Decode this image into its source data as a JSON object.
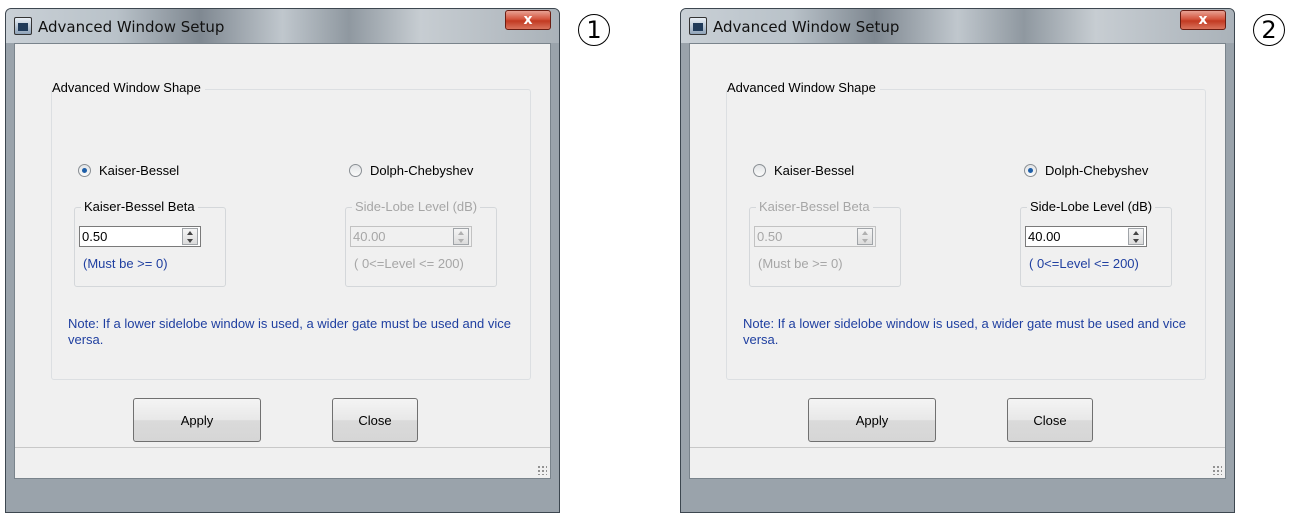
{
  "windows": [
    {
      "title": "Advanced Window Setup",
      "close_glyph": "x",
      "group_title": "Advanced Window Shape",
      "radio_kaiser": "Kaiser-Bessel",
      "radio_dolph": "Dolph-Chebyshev",
      "selected": "Kaiser-Bessel",
      "kaiser_title": "Kaiser-Bessel Beta",
      "kaiser_value": "0.50",
      "kaiser_hint": "(Must be >= 0)",
      "dolph_title": "Side-Lobe Level (dB)",
      "dolph_value": "40.00",
      "dolph_hint": "( 0<=Level <= 200)",
      "note": "Note: If a lower sidelobe window is used, a wider gate must be used and vice versa.",
      "apply_label": "Apply",
      "close_label": "Close",
      "badge": "1"
    },
    {
      "title": "Advanced Window Setup",
      "close_glyph": "x",
      "group_title": "Advanced Window Shape",
      "radio_kaiser": "Kaiser-Bessel",
      "radio_dolph": "Dolph-Chebyshev",
      "selected": "Dolph-Chebyshev",
      "kaiser_title": "Kaiser-Bessel Beta",
      "kaiser_value": "0.50",
      "kaiser_hint": "(Must be >= 0)",
      "dolph_title": "Side-Lobe Level (dB)",
      "dolph_value": "40.00",
      "dolph_hint": "( 0<=Level <= 200)",
      "note": "Note: If a lower sidelobe window is used, a wider gate must be used and vice versa.",
      "apply_label": "Apply",
      "close_label": "Close",
      "badge": "2"
    }
  ],
  "colors": {
    "hint_text": "#1f3fa0",
    "radio_dot": "#1f5fa8",
    "disabled_text": "#a6a6a6",
    "close_button": "#c23a22"
  },
  "icons": {
    "app": "app-window-icon",
    "close": "close-icon",
    "spin": "spin-up-down-icon",
    "grip": "resize-grip-icon"
  }
}
